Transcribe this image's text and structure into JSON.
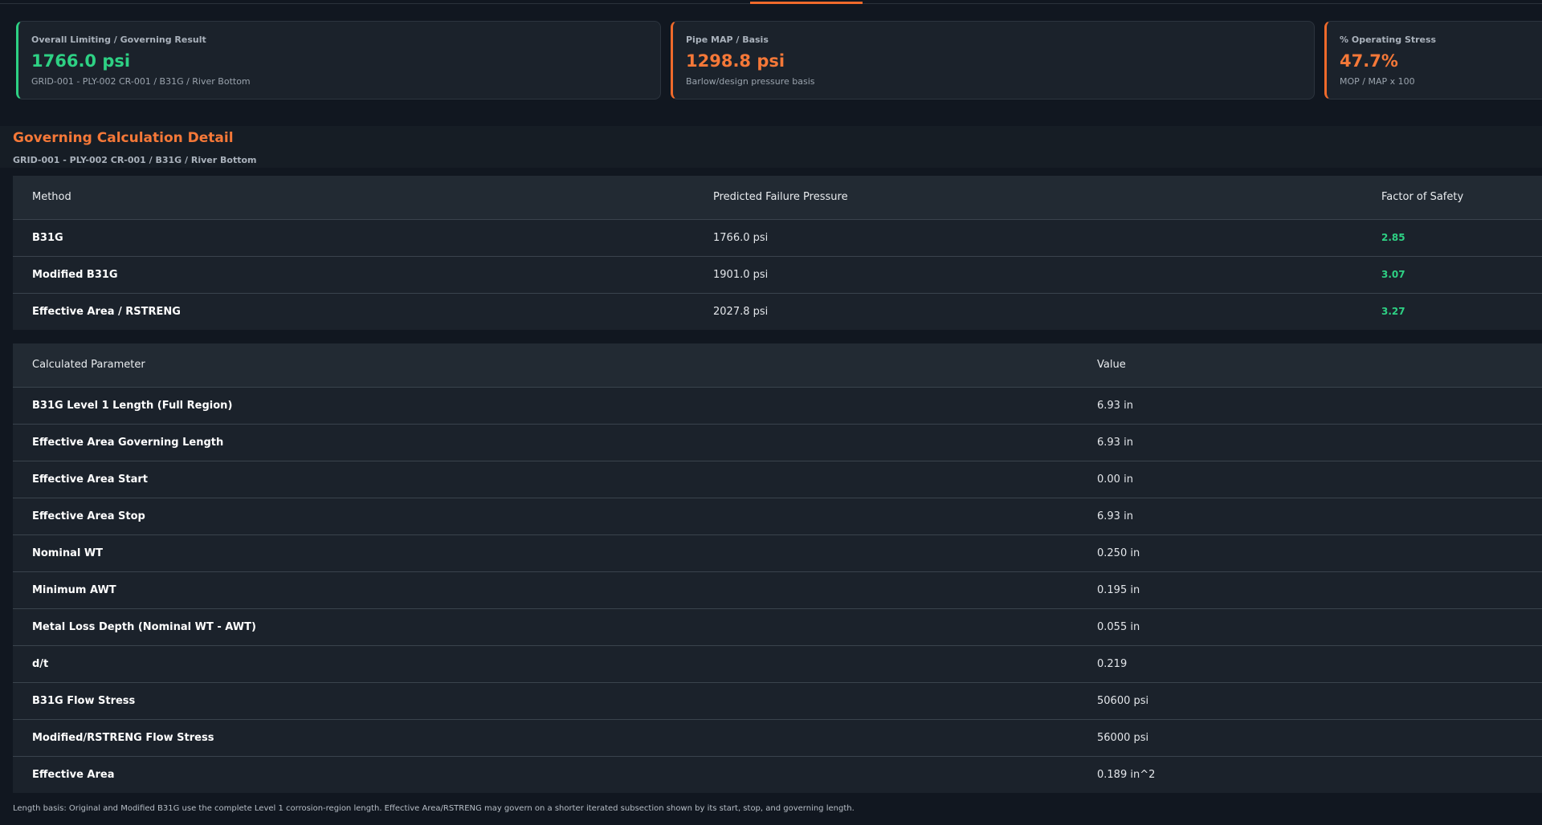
{
  "cards": [
    {
      "label": "Overall Limiting / Governing Result",
      "value": "1766.0 psi",
      "sub": "GRID-001 - PLY-002 CR-001 / B31G / River Bottom"
    },
    {
      "label": "Pipe MAP / Basis",
      "value": "1298.8 psi",
      "sub": "Barlow/design pressure basis"
    },
    {
      "label": "% Operating Stress",
      "value": "47.7%",
      "sub": "MOP / MAP x 100"
    }
  ],
  "colors": {
    "accent_green": "#2ed184",
    "accent_orange": "#f06a2b",
    "background": "#111720"
  },
  "section": {
    "title": "Governing Calculation Detail",
    "subtitle": "GRID-001 - PLY-002 CR-001 / B31G / River Bottom"
  },
  "methods_table": {
    "headers": [
      "Method",
      "Predicted Failure Pressure",
      "Factor of Safety"
    ],
    "rows": [
      [
        "B31G",
        "1766.0 psi",
        "2.85"
      ],
      [
        "Modified B31G",
        "1901.0 psi",
        "3.07"
      ],
      [
        "Effective Area / RSTRENG",
        "2027.8 psi",
        "3.27"
      ]
    ]
  },
  "params_table": {
    "headers": [
      "Calculated Parameter",
      "Value"
    ],
    "rows": [
      [
        "B31G Level 1 Length (Full Region)",
        "6.93 in"
      ],
      [
        "Effective Area Governing Length",
        "6.93 in"
      ],
      [
        "Effective Area Start",
        "0.00 in"
      ],
      [
        "Effective Area Stop",
        "6.93 in"
      ],
      [
        "Nominal WT",
        "0.250 in"
      ],
      [
        "Minimum AWT",
        "0.195 in"
      ],
      [
        "Metal Loss Depth (Nominal WT - AWT)",
        "0.055 in"
      ],
      [
        "d/t",
        "0.219"
      ],
      [
        "B31G Flow Stress",
        "50600 psi"
      ],
      [
        "Modified/RSTRENG Flow Stress",
        "56000 psi"
      ],
      [
        "Effective Area",
        "0.189 in^2"
      ]
    ]
  },
  "footnote": "Length basis: Original and Modified B31G use the complete Level 1 corrosion-region length. Effective Area/RSTRENG may govern on a shorter iterated subsection shown by its start, stop, and governing length."
}
